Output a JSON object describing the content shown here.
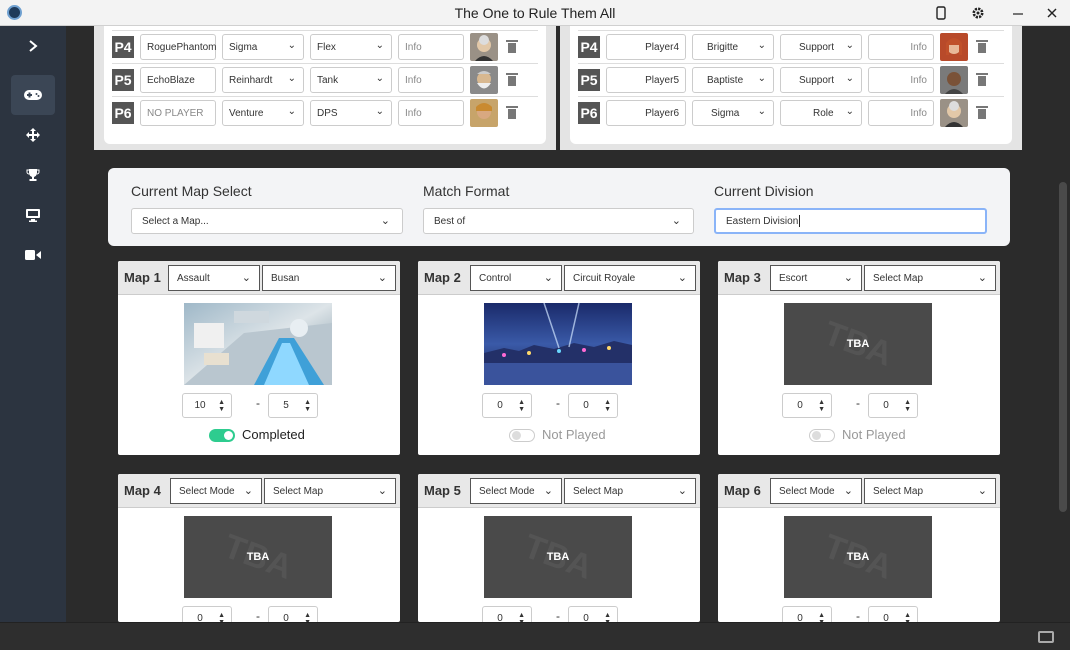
{
  "window": {
    "title": "The One to Rule Them All"
  },
  "colors": {
    "sidebar": "#2c3440",
    "active_toggle": "#2ecc8f",
    "focus_border": "#8ab4f8"
  },
  "sidebar": {
    "items": [
      {
        "icon": "chevron-right-icon"
      },
      {
        "icon": "gamepad-icon"
      },
      {
        "icon": "move-arrows-icon"
      },
      {
        "icon": "trophy-icon"
      },
      {
        "icon": "monitor-icon"
      },
      {
        "icon": "video-camera-icon"
      }
    ]
  },
  "team1": {
    "players": [
      {
        "badge": "P4",
        "name": "RoguePhantom",
        "hero": "Sigma",
        "role": "Flex",
        "info": "Info"
      },
      {
        "badge": "P5",
        "name": "EchoBlaze",
        "hero": "Reinhardt",
        "role": "Tank",
        "info": "Info"
      },
      {
        "badge": "P6",
        "name": "NO PLAYER",
        "hero": "Venture",
        "role": "DPS",
        "info": "Info"
      }
    ]
  },
  "team2": {
    "players": [
      {
        "badge": "P4",
        "name": "Player4",
        "hero": "Brigitte",
        "role": "Support",
        "info": "Info"
      },
      {
        "badge": "P5",
        "name": "Player5",
        "hero": "Baptiste",
        "role": "Support",
        "info": "Info"
      },
      {
        "badge": "P6",
        "name": "Player6",
        "hero": "Sigma",
        "role": "Role",
        "info": "Info"
      }
    ]
  },
  "settings": {
    "map_label": "Current Map Select",
    "map_value": "Select a Map...",
    "format_label": "Match Format",
    "format_value": "Best of",
    "division_label": "Current Division",
    "division_value": "Eastern Division"
  },
  "maps": [
    {
      "title": "Map 1",
      "mode": "Assault",
      "map": "Busan",
      "score_a": "10",
      "score_b": "5",
      "status": "Completed",
      "completed": true,
      "image": "busan"
    },
    {
      "title": "Map 2",
      "mode": "Control",
      "map": "Circuit Royale",
      "score_a": "0",
      "score_b": "0",
      "status": "Not Played",
      "completed": false,
      "image": "circuit"
    },
    {
      "title": "Map 3",
      "mode": "Escort",
      "map": "Select Map",
      "score_a": "0",
      "score_b": "0",
      "status": "Not Played",
      "completed": false,
      "image": "tba"
    },
    {
      "title": "Map 4",
      "mode": "Select Mode",
      "map": "Select Map",
      "score_a": "0",
      "score_b": "0",
      "image": "tba"
    },
    {
      "title": "Map 5",
      "mode": "Select Mode",
      "map": "Select Map",
      "score_a": "0",
      "score_b": "0",
      "image": "tba"
    },
    {
      "title": "Map 6",
      "mode": "Select Mode",
      "map": "Select Map",
      "score_a": "0",
      "score_b": "0",
      "image": "tba"
    }
  ],
  "tba_text": "TBA"
}
